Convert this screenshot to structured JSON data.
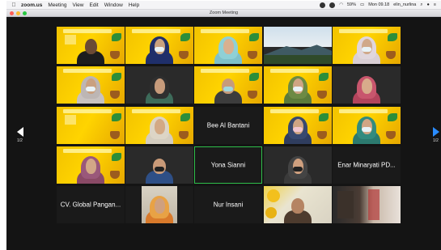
{
  "menubar": {
    "app": "zoom.us",
    "items": [
      "Meeting",
      "View",
      "Edit",
      "Window",
      "Help"
    ],
    "battery": "59%",
    "clock": "Mon 09.18",
    "user": "elin_nurlina"
  },
  "window": {
    "title": "Zoom Meeting"
  },
  "pager": {
    "left": "1/2",
    "right": "1/2"
  },
  "tiles": {
    "bee": "Bee Al Bantani",
    "yona": "Yona Sianni",
    "enar": "Enar Minaryati PD...",
    "cv": "CV. Global Pangan...",
    "nur": "Nur Insani"
  },
  "colors": {
    "meeting_bg": "#141414",
    "active_speaker": "#2fbf4a",
    "virtual_bg": "#ffd400",
    "next_page_arrow": "#2a8cff"
  }
}
